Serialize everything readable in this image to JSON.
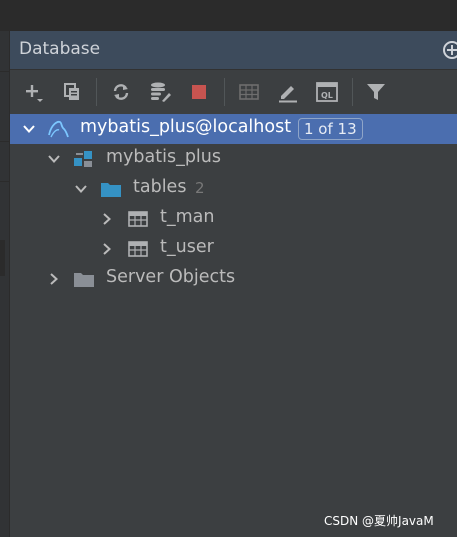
{
  "panel": {
    "title": "Database"
  },
  "toolbar": {
    "buttons": [
      {
        "icon": "add-icon"
      },
      {
        "icon": "copy-icon"
      },
      {
        "icon": "refresh-icon"
      },
      {
        "icon": "properties-icon"
      },
      {
        "icon": "stop-icon"
      },
      {
        "icon": "table-editor-icon"
      },
      {
        "icon": "edit-icon"
      },
      {
        "icon": "sql-console-icon"
      },
      {
        "icon": "filter-icon"
      }
    ],
    "colors": {
      "stop": "#c75450",
      "disabled": "#6e6e6e",
      "icon": "#afb1b3"
    }
  },
  "tree": {
    "connection": {
      "label": "mybatis_plus@localhost",
      "badge": "1 of 13",
      "icon": "mysql-icon"
    },
    "schema": {
      "label": "mybatis_plus",
      "icon": "schema-icon"
    },
    "tables_folder": {
      "label": "tables",
      "count": "2",
      "icon": "folder-icon"
    },
    "tables": [
      {
        "label": "t_man",
        "icon": "table-icon"
      },
      {
        "label": "t_user",
        "icon": "table-icon"
      }
    ],
    "server_objects": {
      "label": "Server Objects",
      "icon": "folder-icon"
    }
  },
  "colors": {
    "selection": "#4b6eaf",
    "header": "#3d4b5c",
    "folder_blue": "#3592c4",
    "folder_gray": "#8a8f96"
  },
  "watermark": "CSDN @夏帅JavaM"
}
